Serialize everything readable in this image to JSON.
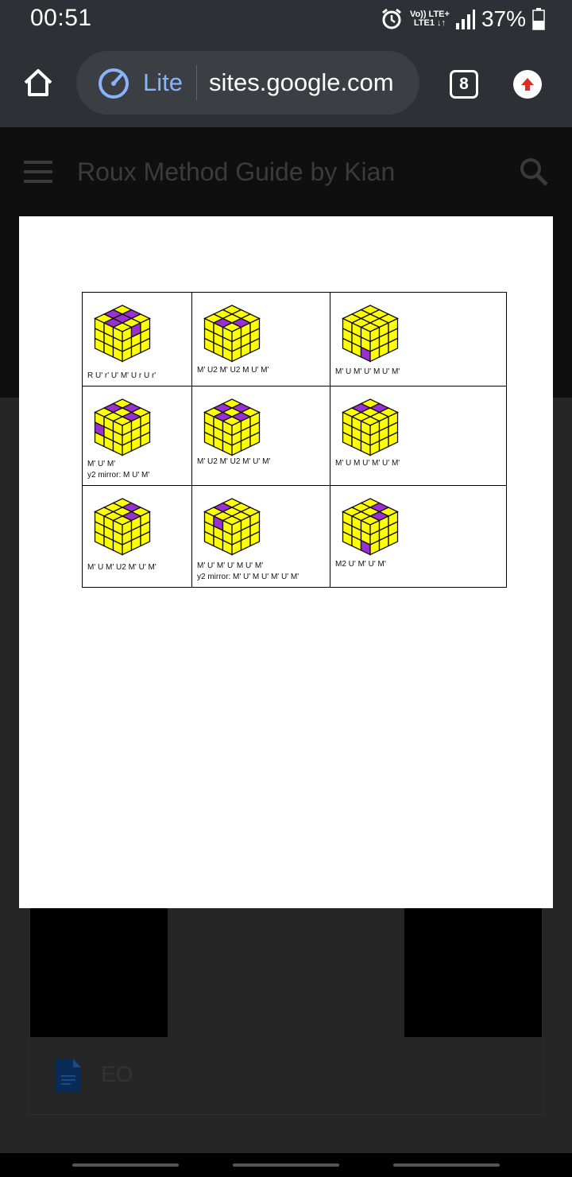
{
  "status_bar": {
    "time": "00:51",
    "network_top": "Vo)) LTE+",
    "network_bottom": "LTE1 ↓↑",
    "battery": "37%"
  },
  "browser": {
    "lite_label": "Lite",
    "url": "sites.google.com",
    "tab_count": "8",
    "accent_color": "#8ab4f8",
    "update_color": "#d93025"
  },
  "site": {
    "title": "Roux Method Guide by Kian",
    "file_name": "EO"
  },
  "cube_colors": {
    "yellow": "#ffff00",
    "purple": "#9b30d0",
    "stroke": "#111111"
  },
  "cases": [
    {
      "line1": "R U' r' U' M' U r U r'",
      "line2": "",
      "top": [
        0,
        1,
        0,
        1,
        1,
        0,
        0,
        1,
        0
      ],
      "right": [
        0,
        1,
        0,
        0,
        0,
        0,
        0,
        0,
        0
      ],
      "left": [
        0,
        0,
        0,
        0,
        0,
        0,
        0,
        0,
        0
      ]
    },
    {
      "line1": "M' U2 M' U2 M U' M'",
      "line2": "",
      "top": [
        0,
        0,
        0,
        0,
        0,
        1,
        0,
        1,
        0
      ],
      "right": [
        0,
        0,
        0,
        0,
        0,
        0,
        0,
        0,
        0
      ],
      "left": [
        0,
        0,
        0,
        0,
        0,
        0,
        0,
        0,
        0
      ]
    },
    {
      "line1": "M' U M' U' M U' M'",
      "line2": "",
      "top": [
        0,
        0,
        0,
        0,
        0,
        0,
        0,
        0,
        0
      ],
      "right": [
        0,
        0,
        0,
        0,
        0,
        0,
        0,
        0,
        0
      ],
      "left": [
        0,
        0,
        0,
        0,
        0,
        0,
        0,
        0,
        1
      ]
    },
    {
      "line1": "M' U' M'",
      "line2": "y2 mirror: M U' M'",
      "top": [
        0,
        1,
        0,
        1,
        0,
        1,
        0,
        0,
        0
      ],
      "right": [
        0,
        0,
        0,
        0,
        0,
        0,
        0,
        0,
        0
      ],
      "left": [
        0,
        0,
        0,
        1,
        0,
        0,
        0,
        0,
        0
      ]
    },
    {
      "line1": "M' U2 M' U2 M' U' M'",
      "line2": "",
      "top": [
        0,
        1,
        0,
        1,
        0,
        1,
        0,
        1,
        0
      ],
      "right": [
        0,
        0,
        0,
        0,
        0,
        0,
        0,
        0,
        0
      ],
      "left": [
        0,
        0,
        0,
        0,
        0,
        0,
        0,
        0,
        0
      ]
    },
    {
      "line1": "M' U M U' M' U' M'",
      "line2": "",
      "top": [
        0,
        1,
        0,
        1,
        0,
        0,
        0,
        0,
        0
      ],
      "right": [
        0,
        0,
        0,
        0,
        0,
        0,
        0,
        0,
        0
      ],
      "left": [
        0,
        0,
        0,
        0,
        0,
        0,
        0,
        0,
        0
      ]
    },
    {
      "line1": "M' U M' U2 M' U' M'",
      "line2": "",
      "top": [
        0,
        1,
        0,
        0,
        0,
        1,
        0,
        0,
        0
      ],
      "right": [
        0,
        0,
        0,
        0,
        0,
        0,
        0,
        0,
        0
      ],
      "left": [
        0,
        0,
        0,
        0,
        0,
        0,
        0,
        0,
        0
      ]
    },
    {
      "line1": "M' U' M' U' M U' M'",
      "line2": "y2 mirror: M' U' M U' M' U' M'",
      "top": [
        0,
        0,
        0,
        1,
        0,
        0,
        0,
        0,
        0
      ],
      "right": [
        0,
        0,
        0,
        0,
        0,
        0,
        0,
        0,
        0
      ],
      "left": [
        0,
        1,
        0,
        0,
        0,
        0,
        0,
        0,
        0
      ]
    },
    {
      "line1": "M2 U' M' U' M'",
      "line2": "",
      "top": [
        0,
        1,
        0,
        0,
        0,
        1,
        0,
        0,
        0
      ],
      "right": [
        0,
        0,
        0,
        0,
        0,
        0,
        0,
        0,
        0
      ],
      "left": [
        0,
        0,
        0,
        0,
        0,
        0,
        0,
        0,
        1
      ]
    }
  ]
}
